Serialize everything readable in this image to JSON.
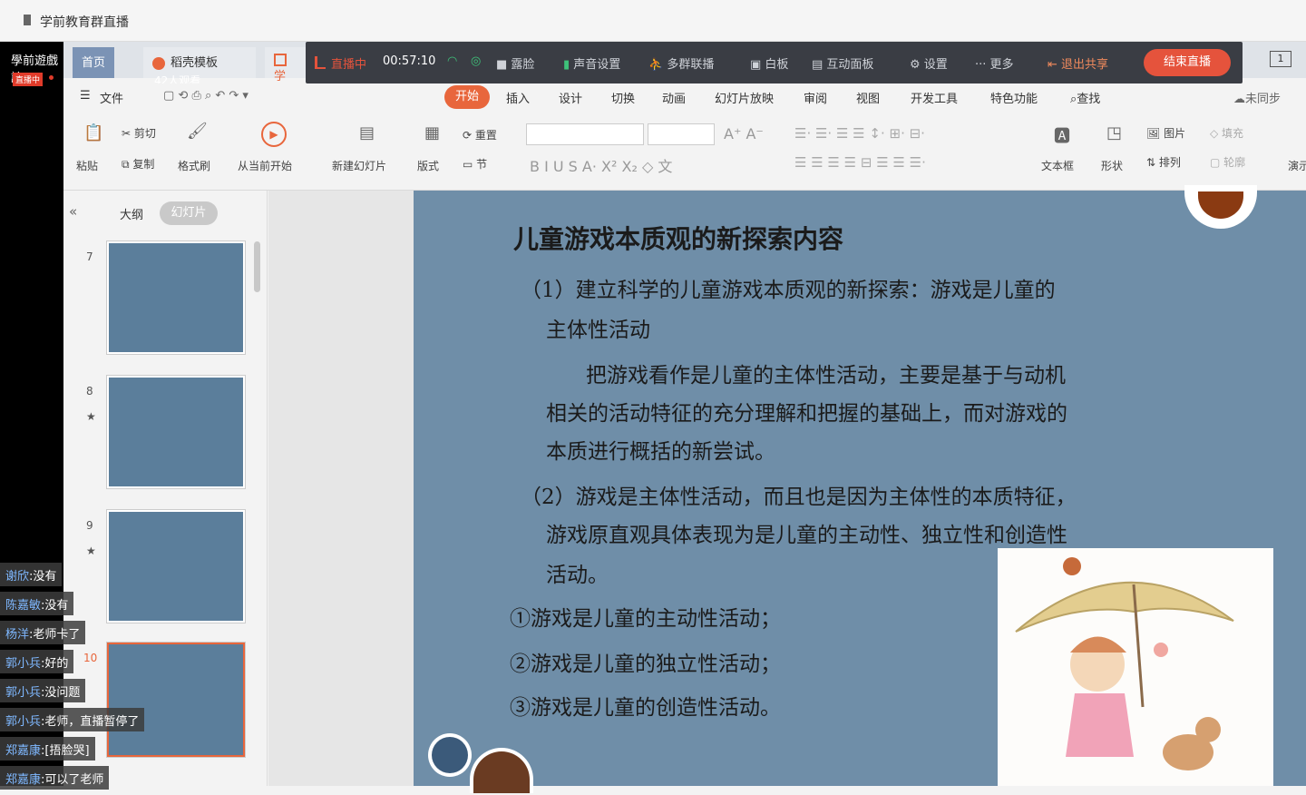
{
  "window": {
    "title": "学前教育群直播"
  },
  "stream": {
    "channel": "學前遊戲論",
    "status_badge": "直播中",
    "viewers": "42人观看"
  },
  "wps_tabs": [
    {
      "label": "首页"
    },
    {
      "label": "稻壳模板"
    },
    {
      "label": "学"
    }
  ],
  "live_bar": {
    "status": "直播中",
    "timer": "00:57:10",
    "items": [
      {
        "label": "露脸"
      },
      {
        "label": "声音设置"
      },
      {
        "label": "多群联播"
      },
      {
        "label": "白板"
      },
      {
        "label": "互动面板"
      },
      {
        "label": "设置"
      },
      {
        "label": "更多"
      },
      {
        "label": "退出共享"
      }
    ],
    "end_label": "结束直播",
    "page_indicator": "1"
  },
  "menu": {
    "file": "文件",
    "tabs": [
      {
        "label": "开始"
      },
      {
        "label": "插入"
      },
      {
        "label": "设计"
      },
      {
        "label": "切换"
      },
      {
        "label": "动画"
      },
      {
        "label": "幻灯片放映"
      },
      {
        "label": "审阅"
      },
      {
        "label": "视图"
      },
      {
        "label": "开发工具"
      },
      {
        "label": "特色功能"
      },
      {
        "label": "查找"
      }
    ],
    "sync": "未同步"
  },
  "ribbon": {
    "paste": "粘贴",
    "cut": "剪切",
    "copy": "复制",
    "format_painter": "格式刷",
    "from_current": "从当前开始",
    "new_slide": "新建幻灯片",
    "layout": "版式",
    "reset": "重置",
    "section": "节",
    "textbox": "文本框",
    "shape": "形状",
    "picture": "图片",
    "arrange": "排列",
    "fill": "填充",
    "outline": "轮廓",
    "present": "演示"
  },
  "panel": {
    "outline_tab": "大纲",
    "slides_tab": "幻灯片",
    "slide_numbers": [
      {
        "n": "7"
      },
      {
        "n": "8"
      },
      {
        "n": "9"
      },
      {
        "n": "10"
      }
    ]
  },
  "slide": {
    "title": "儿童游戏本质观的新探索内容",
    "lines": [
      "（1）建立科学的儿童游戏本质观的新探索：游戏是儿童的",
      "主体性活动",
      "把游戏看作是儿童的主体性活动，主要是基于与动机",
      "相关的活动特征的充分理解和把握的基础上，而对游戏的",
      "本质进行概括的新尝试。",
      "（2）游戏是主体性活动，而且也是因为主体性的本质特征，",
      "游戏原直观具体表现为是儿童的主动性、独立性和创造性",
      "活动。",
      "①游戏是儿童的主动性活动；",
      "②游戏是儿童的独立性活动；",
      "③游戏是儿童的创造性活动。"
    ]
  },
  "chat": [
    {
      "name": "谢欣",
      "msg": "没有"
    },
    {
      "name": "陈嘉敏",
      "msg": "没有"
    },
    {
      "name": "杨洋",
      "msg": "老师卡了"
    },
    {
      "name": "郭小兵",
      "msg": "好的"
    },
    {
      "name": "郭小兵",
      "msg": "没问题"
    },
    {
      "name": "郭小兵",
      "msg": "老师，直播暂停了"
    },
    {
      "name": "郑嘉康",
      "msg": "[捂脸哭]"
    },
    {
      "name": "郑嘉康",
      "msg": "可以了老师"
    }
  ],
  "colors": {
    "accent": "#e8663c",
    "slide_bg": "#6f8ea8",
    "live_bar": "#3a3d44",
    "end_button": "#e5533c"
  }
}
